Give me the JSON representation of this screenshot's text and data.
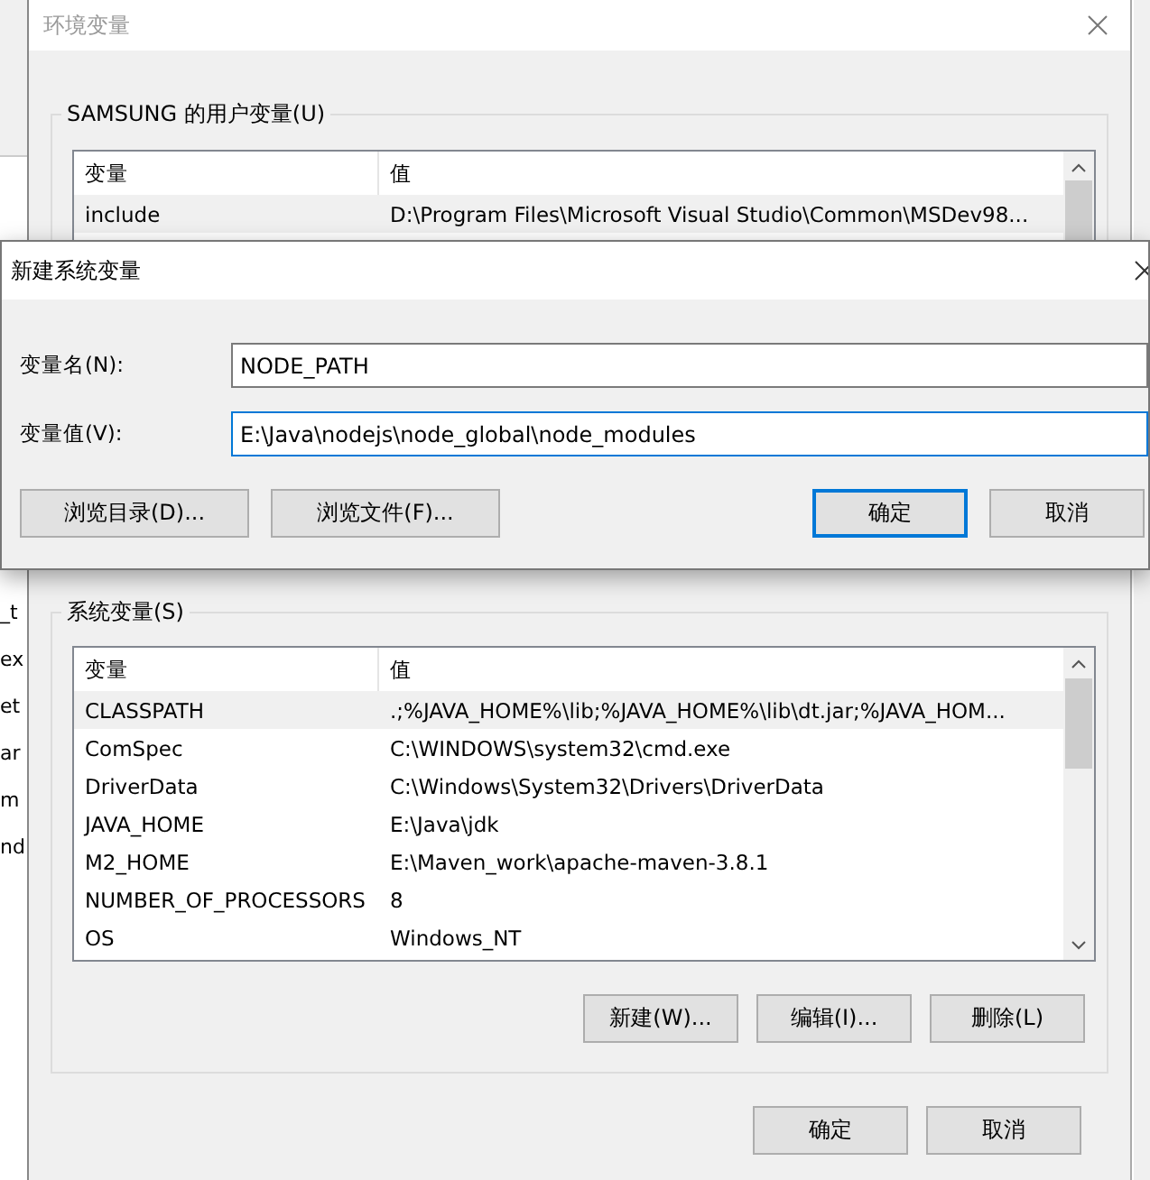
{
  "background_window": {
    "text_fragments": [
      "_t",
      "ex",
      "et",
      "ar",
      "m",
      "nd"
    ]
  },
  "env_window": {
    "title": "环境变量",
    "user_vars": {
      "title": "SAMSUNG 的用户变量(U)",
      "columns": [
        "变量",
        "值"
      ],
      "rows": [
        {
          "name": "include",
          "value": "D:\\Program Files\\Microsoft Visual Studio\\Common\\MSDev98...",
          "selected": true
        }
      ]
    },
    "system_vars": {
      "title": "系统变量(S)",
      "columns": [
        "变量",
        "值"
      ],
      "rows": [
        {
          "name": "CLASSPATH",
          "value": ".;%JAVA_HOME%\\lib;%JAVA_HOME%\\lib\\dt.jar;%JAVA_HOM...",
          "selected": true
        },
        {
          "name": "ComSpec",
          "value": "C:\\WINDOWS\\system32\\cmd.exe",
          "selected": false
        },
        {
          "name": "DriverData",
          "value": "C:\\Windows\\System32\\Drivers\\DriverData",
          "selected": false
        },
        {
          "name": "JAVA_HOME",
          "value": "E:\\Java\\jdk",
          "selected": false
        },
        {
          "name": "M2_HOME",
          "value": "E:\\Maven_work\\apache-maven-3.8.1",
          "selected": false
        },
        {
          "name": "NUMBER_OF_PROCESSORS",
          "value": "8",
          "selected": false
        },
        {
          "name": "OS",
          "value": "Windows_NT",
          "selected": false
        }
      ],
      "buttons": [
        "新建(W)...",
        "编辑(I)...",
        "删除(L)"
      ]
    },
    "buttons": [
      "确定",
      "取消"
    ]
  },
  "dialog": {
    "title": "新建系统变量",
    "fields": [
      {
        "label": "变量名(N):",
        "value": "NODE_PATH",
        "focused": false
      },
      {
        "label": "变量值(V):",
        "value": "E:\\Java\\nodejs\\node_global\\node_modules",
        "focused": true
      }
    ],
    "buttons": [
      {
        "label": "浏览目录(D)...",
        "default": false
      },
      {
        "label": "浏览文件(F)...",
        "default": false
      },
      {
        "label": "确定",
        "default": true
      },
      {
        "label": "取消",
        "default": false
      }
    ]
  }
}
